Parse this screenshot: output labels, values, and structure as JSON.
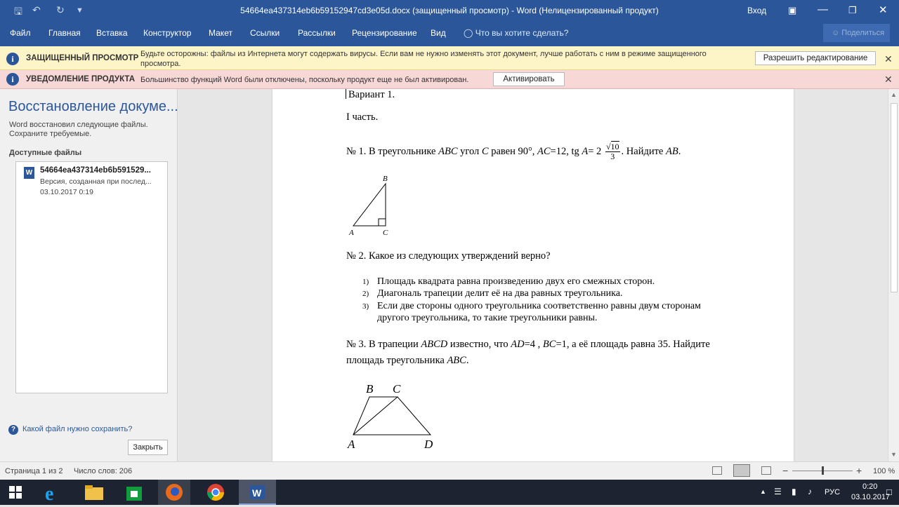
{
  "window": {
    "title": "54664ea437314eb6b59152947cd3e05d.docx (защищенный просмотр)  -  Word (Нелицензированный продукт)",
    "signin": "Вход"
  },
  "ribbon": {
    "tabs": [
      "Файл",
      "Главная",
      "Вставка",
      "Конструктор",
      "Макет",
      "Ссылки",
      "Рассылки",
      "Рецензирование",
      "Вид"
    ],
    "tellme": "Что вы хотите сделать?",
    "share": "Поделиться"
  },
  "protected_bar": {
    "title": "ЗАЩИЩЕННЫЙ ПРОСМОТР",
    "text_line1": "Будьте осторожны: файлы из Интернета могут содержать вирусы. Если вам не нужно изменять этот документ, лучше работать с ним в режиме защищенного",
    "text_line2": "просмотра.",
    "button": "Разрешить редактирование"
  },
  "product_bar": {
    "title": "УВЕДОМЛЕНИЕ ПРОДУКТА",
    "text": "Большинство функций Word были отключены, поскольку продукт еще не был активирован.",
    "button": "Активировать"
  },
  "recovery": {
    "title": "Восстановление докуме...",
    "desc_line1": "Word восстановил следующие файлы.",
    "desc_line2": "Сохраните требуемые.",
    "available": "Доступные файлы",
    "file": {
      "name": "54664ea437314eb6b591529...",
      "version": "Версия, созданная при послед...",
      "date": "03.10.2017 0:19"
    },
    "help": "Какой файл нужно сохранить?",
    "close": "Закрыть"
  },
  "document": {
    "variant": "Вариант 1.",
    "part": "I часть.",
    "q1": {
      "p1": "№ 1. В треугольнике ",
      "abc": "ABC",
      "p2": " угол ",
      "c": "C",
      "p3": " равен 90°, ",
      "ac": "AC",
      "p4": "=12, tg ",
      "a": "A",
      "p5": "= 2",
      "root": "10",
      "den": "3",
      "p6": ". Найдите ",
      "ab": "AB",
      "p7": "."
    },
    "fig1": {
      "A": "A",
      "B": "B",
      "C": "C"
    },
    "q2": {
      "text": "№ 2. Какое из следующих утверждений верно?",
      "items": [
        {
          "num": "1)",
          "line1": "Площадь квадрата равна произведению двух его смежных сторон.",
          "line2": ""
        },
        {
          "num": "2)",
          "line1": "Диагональ трапеции делит её на два равных треугольника.",
          "line2": ""
        },
        {
          "num": "3)",
          "line1": "Если две стороны одного треугольника соответственно равны двум сторонам",
          "line2": "другого треугольника, то такие треугольники равны."
        }
      ]
    },
    "q3": {
      "p1": "№ 3. В трапеции ",
      "abcd": "ABCD",
      "p2": " известно, что ",
      "ad": "AD",
      "p3": "=4 , ",
      "bc": "BC",
      "p4": "=1, а её площадь равна 35. Найдите",
      "line2a": "площадь треугольника ",
      "abc": "ABC",
      "line2b": "."
    },
    "fig3": {
      "A": "A",
      "B": "B",
      "C": "C",
      "D": "D"
    }
  },
  "statusbar": {
    "page": "Страница 1 из 2",
    "words": "Число слов: 206",
    "zoom_percent": "100 %",
    "zoom_level": 0.5
  },
  "taskbar": {
    "lang": "РУС",
    "time": "0:20",
    "date": "03.10.2017"
  },
  "colors": {
    "word_blue": "#2b579a",
    "warning_yellow": "#fdf5c8",
    "notice_red": "#f8d7d7"
  }
}
